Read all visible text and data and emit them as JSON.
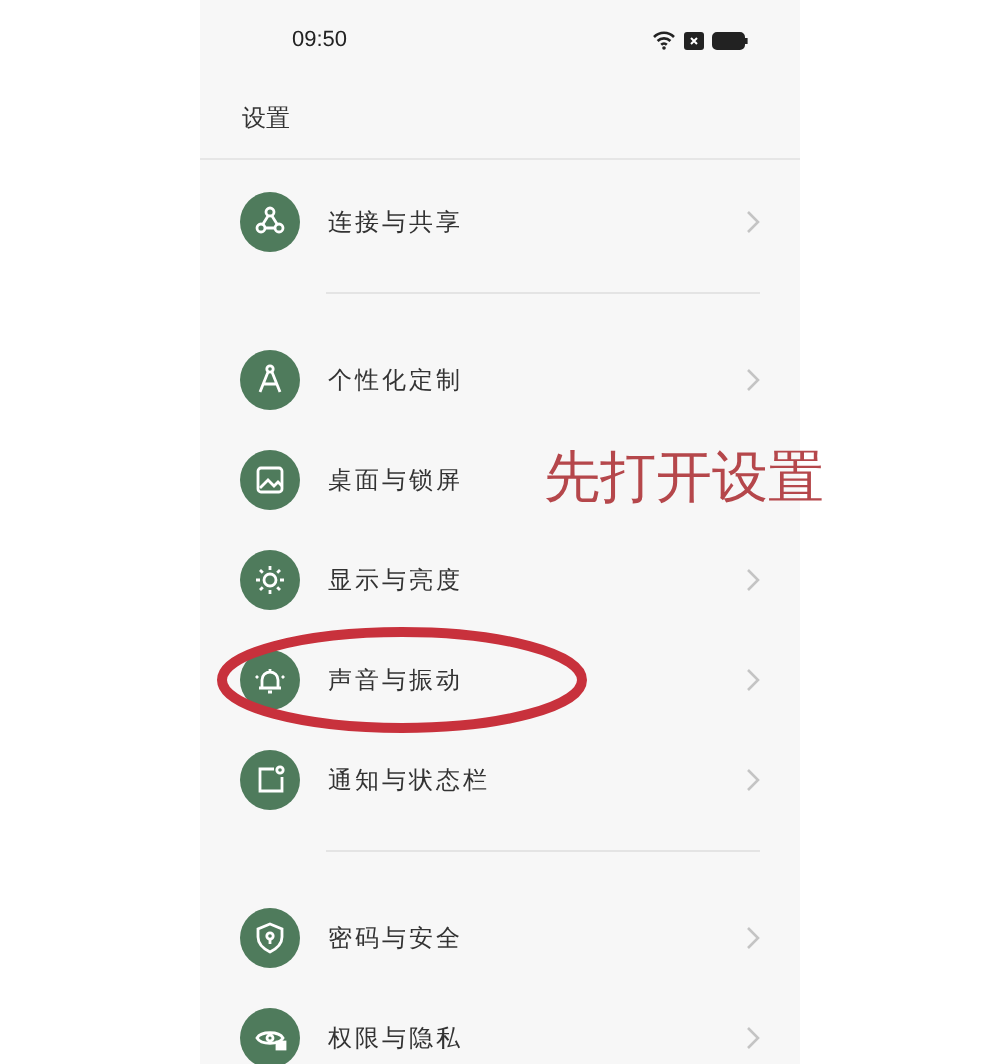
{
  "status_bar": {
    "time": "09:50"
  },
  "title": "设置",
  "groups": [
    {
      "items": [
        {
          "label": "连接与共享",
          "kind": "share",
          "chevron": true,
          "circled": false
        }
      ]
    },
    {
      "items": [
        {
          "label": "个性化定制",
          "kind": "compass",
          "chevron": true,
          "circled": false
        },
        {
          "label": "桌面与锁屏",
          "kind": "image",
          "chevron": false,
          "circled": false
        },
        {
          "label": "显示与亮度",
          "kind": "sun",
          "chevron": true,
          "circled": false
        },
        {
          "label": "声音与振动",
          "kind": "bell",
          "chevron": true,
          "circled": true
        },
        {
          "label": "通知与状态栏",
          "kind": "notice",
          "chevron": true,
          "circled": false
        }
      ]
    },
    {
      "items": [
        {
          "label": "密码与安全",
          "kind": "shield",
          "chevron": true,
          "circled": false
        },
        {
          "label": "权限与隐私",
          "kind": "eye",
          "chevron": true,
          "circled": false
        }
      ]
    }
  ],
  "annotation": {
    "text": "先打开设置"
  }
}
